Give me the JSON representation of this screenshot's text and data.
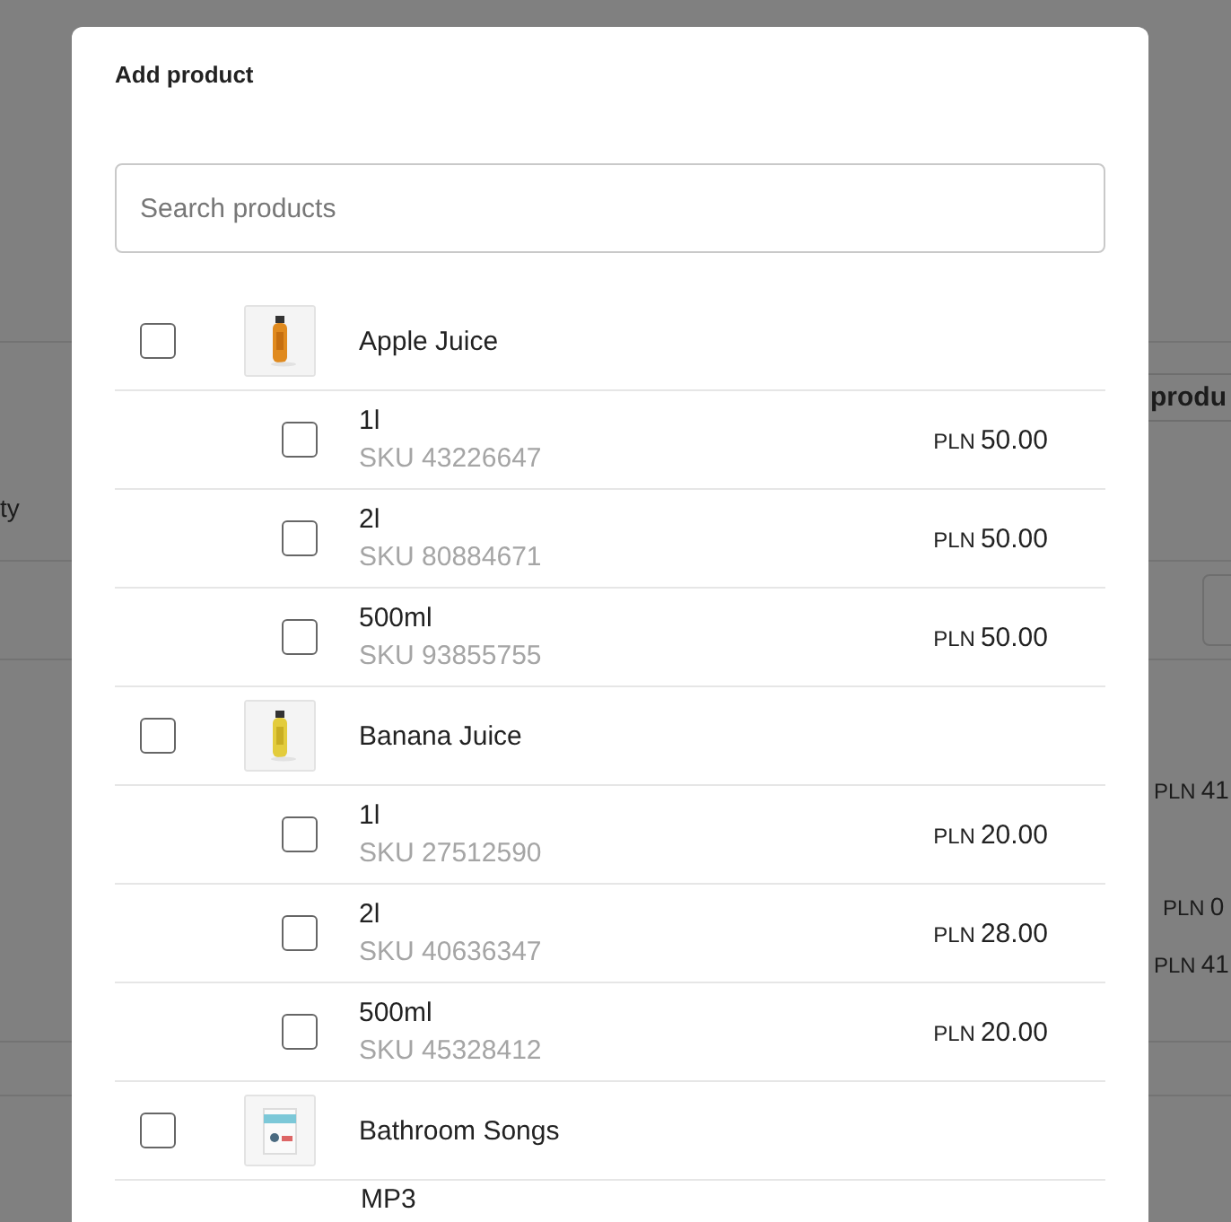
{
  "background": {
    "column_label": "ty",
    "button": "produ",
    "amounts": [
      {
        "currency": "PLN",
        "value": "41"
      },
      {
        "currency": "PLN",
        "value": "0"
      },
      {
        "currency": "PLN",
        "value": "41"
      }
    ]
  },
  "dialog": {
    "title": "Add product",
    "search": {
      "placeholder": "Search products"
    },
    "products": [
      {
        "name": "Apple Juice",
        "checked": false,
        "variants": [
          {
            "name": "1l",
            "sku": "SKU 43226647",
            "currency": "PLN",
            "price": "50.00",
            "checked": false
          },
          {
            "name": "2l",
            "sku": "SKU 80884671",
            "currency": "PLN",
            "price": "50.00",
            "checked": false
          },
          {
            "name": "500ml",
            "sku": "SKU 93855755",
            "currency": "PLN",
            "price": "50.00",
            "checked": false
          }
        ]
      },
      {
        "name": "Banana Juice",
        "checked": false,
        "variants": [
          {
            "name": "1l",
            "sku": "SKU 27512590",
            "currency": "PLN",
            "price": "20.00",
            "checked": false
          },
          {
            "name": "2l",
            "sku": "SKU 40636347",
            "currency": "PLN",
            "price": "28.00",
            "checked": false
          },
          {
            "name": "500ml",
            "sku": "SKU 45328412",
            "currency": "PLN",
            "price": "20.00",
            "checked": false
          }
        ]
      },
      {
        "name": "Bathroom Songs",
        "checked": false,
        "variants": [
          {
            "name": "MP3"
          }
        ]
      }
    ]
  }
}
